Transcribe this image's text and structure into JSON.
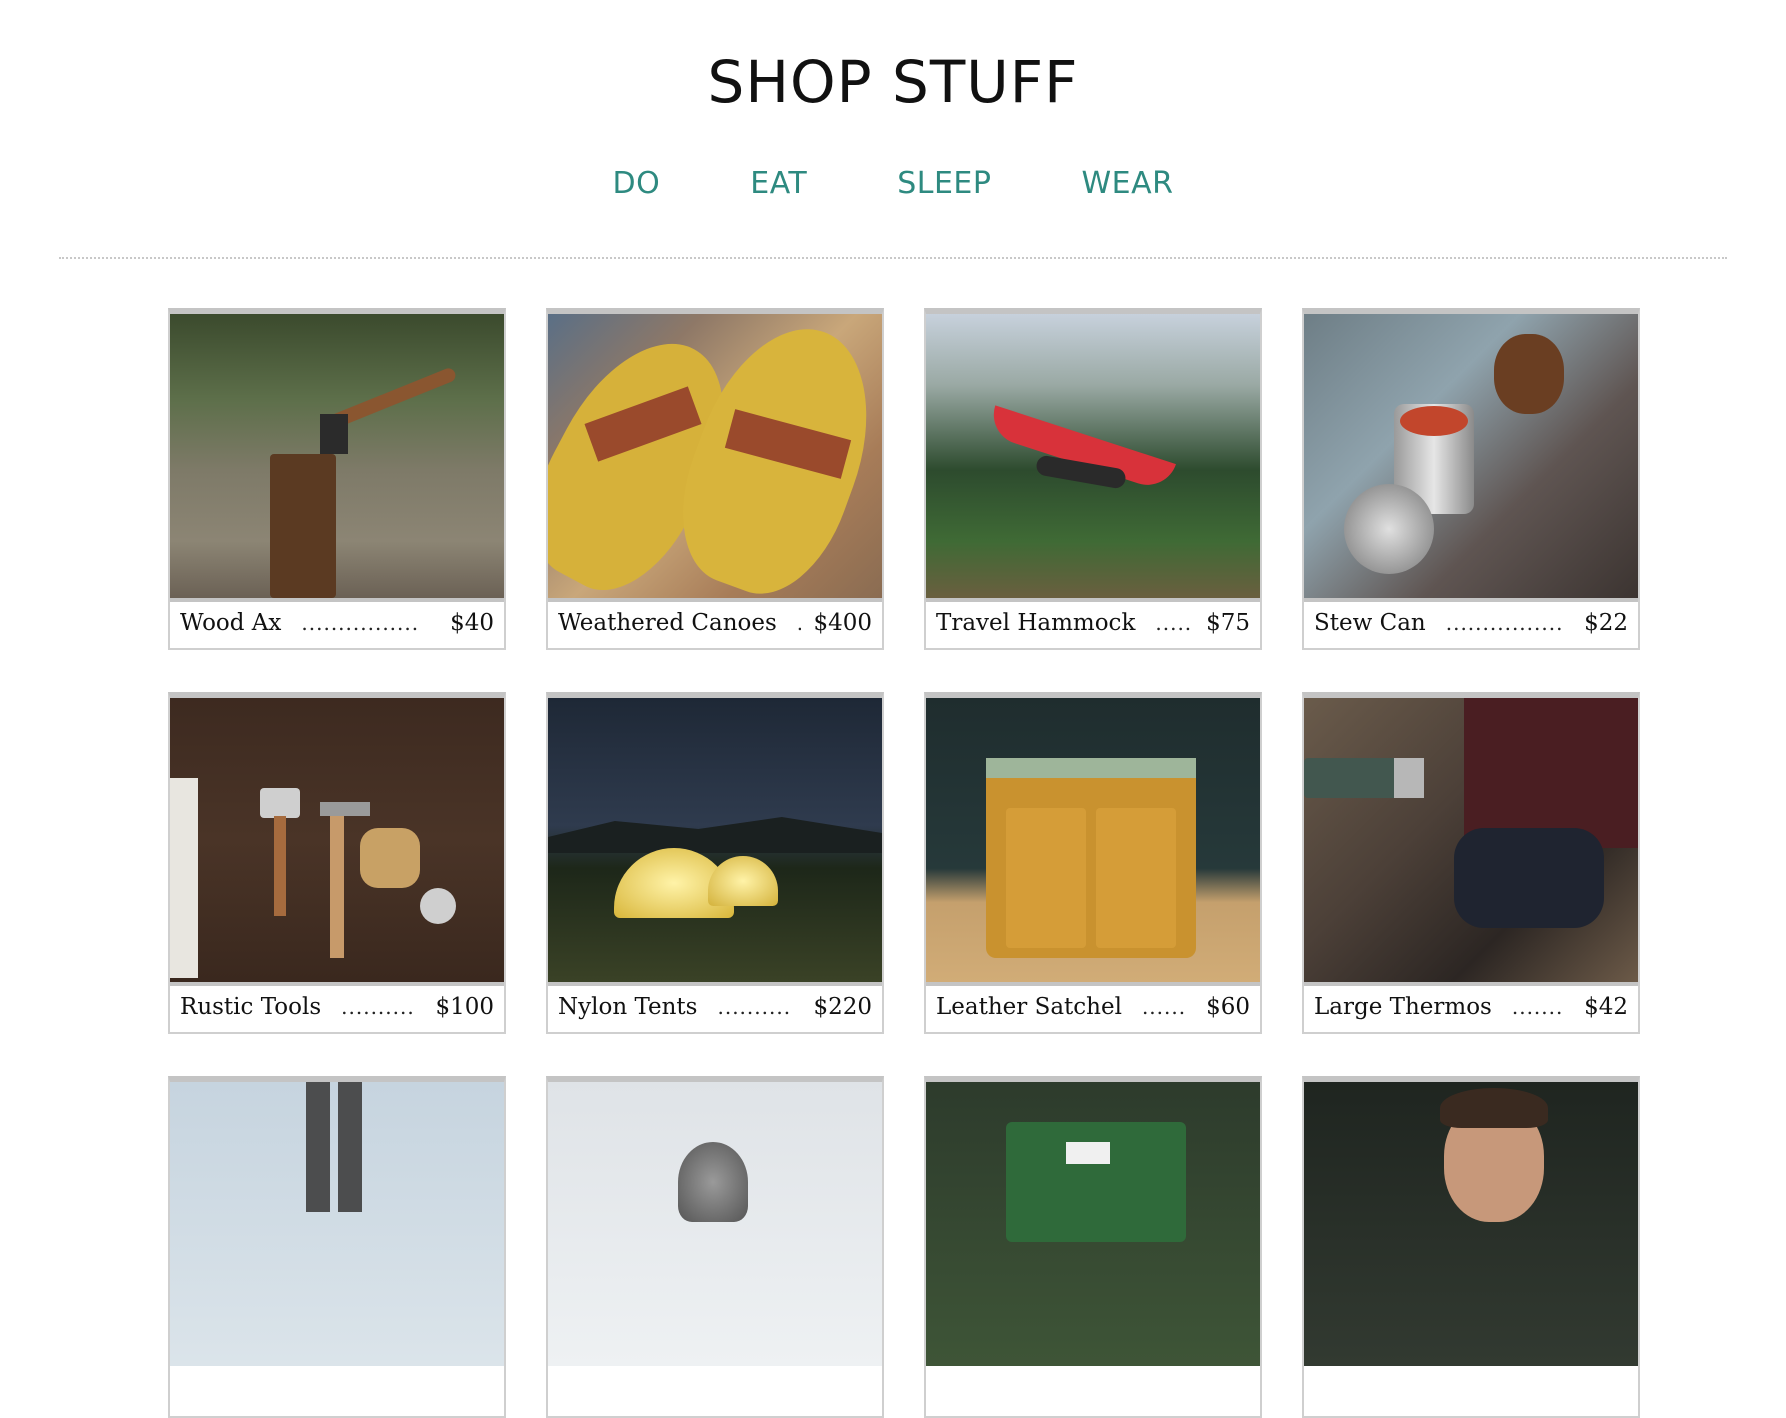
{
  "header": {
    "title": "SHOP STUFF"
  },
  "nav": {
    "items": [
      "DO",
      "EAT",
      "SLEEP",
      "WEAR"
    ]
  },
  "products": [
    {
      "name": "Wood Ax",
      "dots": "................",
      "price": "$40"
    },
    {
      "name": "Weathered Canoes",
      "dots": ".",
      "price": "$400"
    },
    {
      "name": "Travel Hammock",
      "dots": ".....",
      "price": "$75"
    },
    {
      "name": "Stew Can",
      "dots": "................",
      "price": "$22"
    },
    {
      "name": "Rustic Tools",
      "dots": "..........",
      "price": "$100"
    },
    {
      "name": "Nylon Tents",
      "dots": "..........",
      "price": "$220"
    },
    {
      "name": "Leather Satchel",
      "dots": "......",
      "price": "$60"
    },
    {
      "name": "Large Thermos",
      "dots": ".......",
      "price": "$42"
    }
  ],
  "colors": {
    "accent": "#2e8a80",
    "border": "#c4c4c4"
  }
}
